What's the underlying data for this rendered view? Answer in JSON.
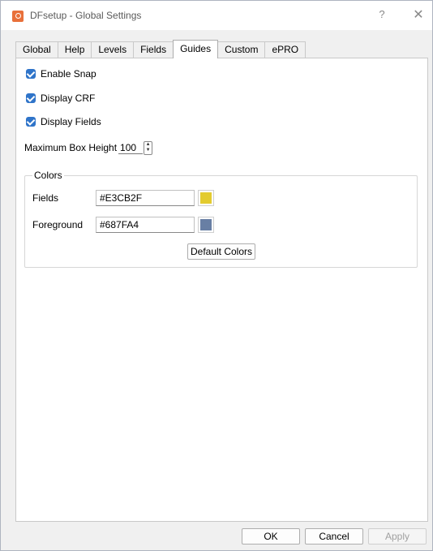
{
  "window": {
    "title": "DFsetup - Global Settings",
    "help_glyph": "?",
    "close_glyph": "✕"
  },
  "tabs": [
    {
      "label": "Global"
    },
    {
      "label": "Help"
    },
    {
      "label": "Levels"
    },
    {
      "label": "Fields"
    },
    {
      "label": "Guides",
      "active": true
    },
    {
      "label": "Custom"
    },
    {
      "label": "ePRO"
    }
  ],
  "guides": {
    "enable_snap": {
      "label": "Enable Snap",
      "checked": true
    },
    "display_crf": {
      "label": "Display CRF",
      "checked": true
    },
    "display_fields": {
      "label": "Display Fields",
      "checked": true
    },
    "max_box_height": {
      "label": "Maximum Box Height",
      "value": "100"
    },
    "colors": {
      "title": "Colors",
      "fields": {
        "label": "Fields",
        "value": "#E3CB2F",
        "swatch": "#E3CB2F"
      },
      "foreground": {
        "label": "Foreground",
        "value": "#687FA4",
        "swatch": "#687FA4"
      },
      "default_button": "Default Colors"
    }
  },
  "footer": {
    "ok": "OK",
    "cancel": "Cancel",
    "apply": "Apply"
  },
  "accent": "#2f74c9"
}
